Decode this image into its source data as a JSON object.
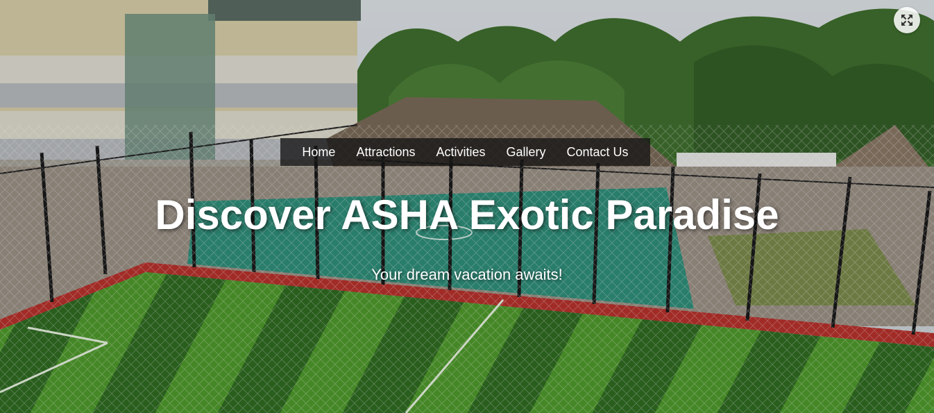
{
  "hero": {
    "title": "Discover ASHA Exotic Paradise",
    "subtitle": "Your dream vacation awaits!"
  },
  "nav": {
    "items": [
      {
        "label": "Home"
      },
      {
        "label": "Attractions"
      },
      {
        "label": "Activities"
      },
      {
        "label": "Gallery"
      },
      {
        "label": "Contact Us"
      }
    ]
  },
  "controls": {
    "fullscreen_icon": "expand-arrows-icon"
  },
  "colors": {
    "nav_background": "#141414",
    "text": "#ffffff",
    "turf_light": "#4f9a2c",
    "turf_dark": "#2f6b22",
    "court": "#2f8f7a",
    "foliage": "#3f6f2e"
  }
}
